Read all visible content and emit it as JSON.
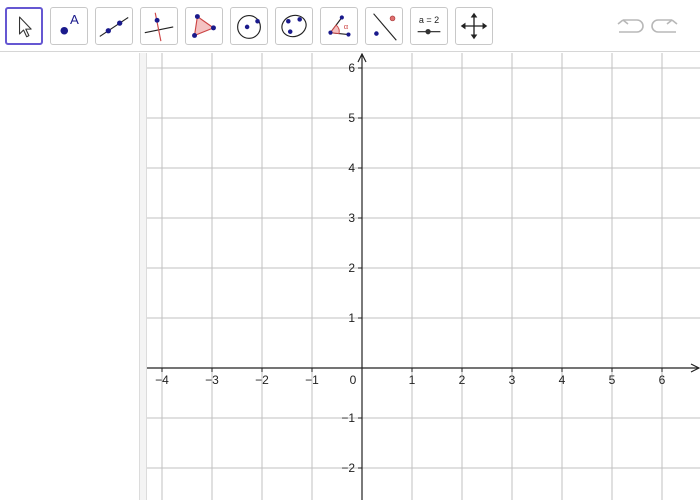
{
  "toolbar": {
    "tools": [
      {
        "name": "move-tool",
        "icon": "arrow-pointer-icon",
        "selected": true
      },
      {
        "name": "point-tool",
        "icon": "point-icon",
        "label": "A"
      },
      {
        "name": "line-tool",
        "icon": "line-through-two-points-icon"
      },
      {
        "name": "perpendicular-line-tool",
        "icon": "perpendicular-line-icon"
      },
      {
        "name": "polygon-tool",
        "icon": "polygon-icon"
      },
      {
        "name": "circle-tool",
        "icon": "circle-with-center-icon"
      },
      {
        "name": "conic-tool",
        "icon": "ellipse-through-points-icon"
      },
      {
        "name": "angle-tool",
        "icon": "angle-icon",
        "label": "α"
      },
      {
        "name": "reflect-tool",
        "icon": "reflect-about-line-icon"
      },
      {
        "name": "slider-tool",
        "icon": "slider-icon",
        "label": "a = 2"
      },
      {
        "name": "move-graphics-view-tool",
        "icon": "move-graphics-view-icon"
      }
    ],
    "undo": {
      "icon": "undo-icon"
    },
    "redo": {
      "icon": "redo-icon"
    }
  },
  "graphics": {
    "x_ticks": [
      "−4",
      "−3",
      "−2",
      "−1",
      "0",
      "1",
      "2",
      "3",
      "4",
      "5",
      "6"
    ],
    "y_ticks": [
      "6",
      "5",
      "4",
      "3",
      "2",
      "1",
      "−1",
      "−2"
    ],
    "x_range": [
      -4.3,
      6.7
    ],
    "y_range": [
      -2.6,
      6.3
    ],
    "grid": true
  },
  "colors": {
    "selected_border": "#6557d2",
    "point": "#1a1a8c",
    "polygon_fill": "#f4c2c2",
    "polygon_stroke": "#cc4444",
    "grid": "#c0c0c0"
  }
}
